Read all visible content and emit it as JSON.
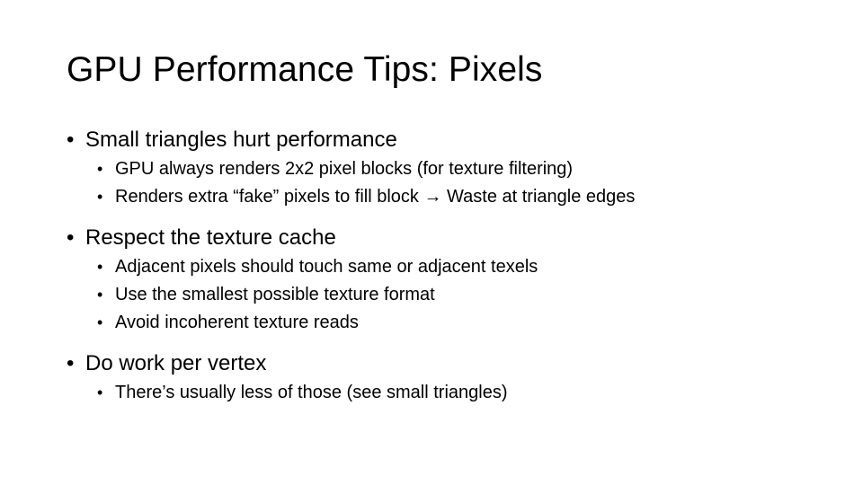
{
  "slide": {
    "title": "GPU Performance Tips: Pixels",
    "bullet_marker": "•",
    "sections": [
      {
        "text": "Small triangles hurt performance",
        "children": [
          {
            "text": "GPU always renders 2x2 pixel blocks (for texture filtering)"
          },
          {
            "text": "Renders extra “fake” pixels to fill block → Waste at triangle edges"
          }
        ]
      },
      {
        "text": "Respect the texture cache",
        "children": [
          {
            "text": "Adjacent pixels should touch same or adjacent texels"
          },
          {
            "text": "Use the smallest possible texture format"
          },
          {
            "text": "Avoid incoherent texture reads"
          }
        ]
      },
      {
        "text": "Do work per vertex",
        "children": [
          {
            "text": "There’s usually less of those (see small triangles)"
          }
        ]
      }
    ]
  },
  "colors": {
    "background": "#ffffff",
    "text": "#000000"
  }
}
